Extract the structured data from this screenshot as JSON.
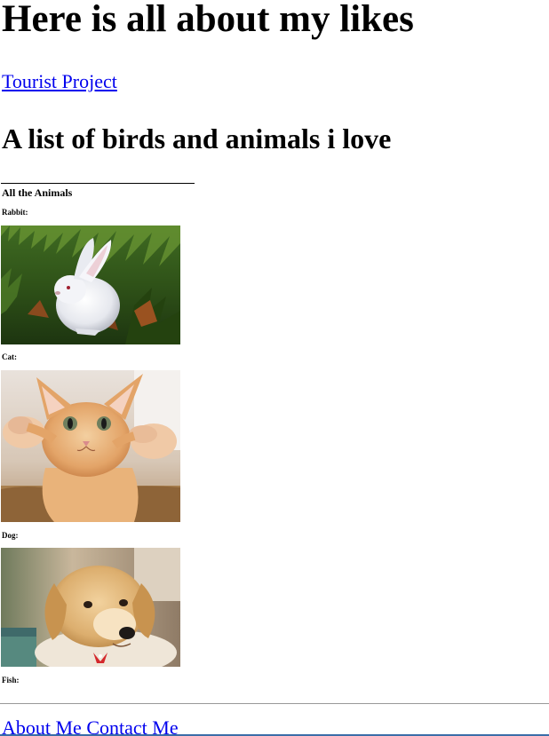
{
  "header": {
    "title": "Here is all about my likes",
    "tourist_link": "Tourist Project"
  },
  "main": {
    "subtitle": "A list of birds and animals i love",
    "section_title": "All the Animals",
    "animals": [
      {
        "label": "Rabbit:"
      },
      {
        "label": "Cat:"
      },
      {
        "label": "Dog:"
      },
      {
        "label": "Fish:"
      }
    ]
  },
  "footer": {
    "about": "About Me",
    "contact": "Contact Me"
  }
}
